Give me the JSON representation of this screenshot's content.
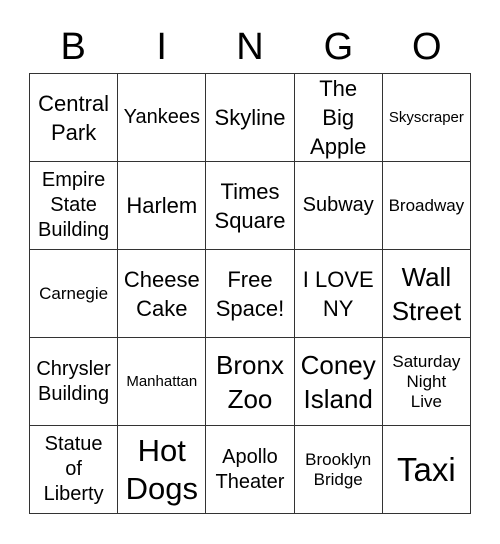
{
  "header": {
    "letters": [
      "B",
      "I",
      "N",
      "G",
      "O"
    ]
  },
  "card": {
    "rows": [
      [
        "Central\nPark",
        "Yankees",
        "Skyline",
        "The\nBig\nApple",
        "Skyscraper"
      ],
      [
        "Empire\nState\nBuilding",
        "Harlem",
        "Times\nSquare",
        "Subway",
        "Broadway"
      ],
      [
        "Carnegie",
        "Cheese\nCake",
        "Free\nSpace!",
        "I LOVE\nNY",
        "Wall\nStreet"
      ],
      [
        "Chrysler\nBuilding",
        "Manhattan",
        "Bronx\nZoo",
        "Coney\nIsland",
        "Saturday\nNight\nLive"
      ],
      [
        "Statue\nof\nLiberty",
        "Hot\nDogs",
        "Apollo\nTheater",
        "Brooklyn\nBridge",
        "Taxi"
      ]
    ]
  }
}
